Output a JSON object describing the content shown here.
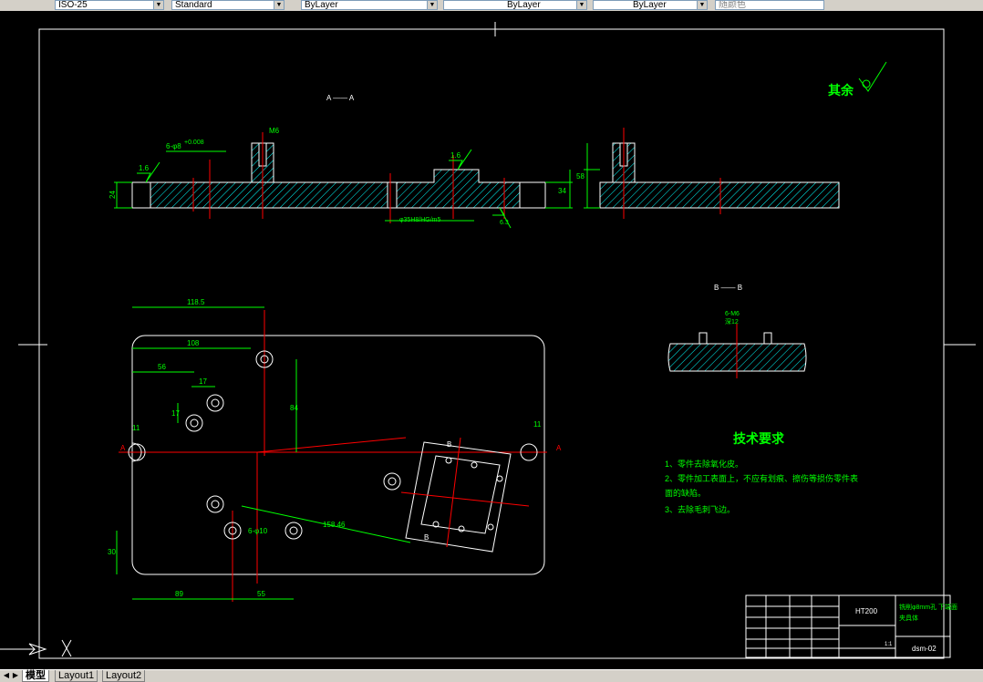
{
  "toolbar": {
    "dimstyle": "ISO-25",
    "textstyle": "Standard",
    "layer_color": "ByLayer",
    "linetype": "ByLayer",
    "lineweight": "ByLayer",
    "plotstyle": "随颜色"
  },
  "drawing": {
    "section_aa": "A —— A",
    "section_bb": "B —— B",
    "roughness_other": "其余",
    "dim_m6": "M6",
    "dim_6phi": "6-φ8",
    "dim_tol": "+0.008",
    "dim_1_6": "1.6",
    "dim_1_6b": "1.6",
    "dim_24": "24",
    "dim_34": "34",
    "dim_58": "58",
    "dim_hole": "φ35H8/HG/m5",
    "dim_6_3": "6.3",
    "dim_118_5": "118.5",
    "dim_108": "108",
    "dim_56": "56",
    "dim_17": "17",
    "dim_17b": "17",
    "dim_84": "84",
    "dim_11": "11",
    "dim_11b": "11",
    "dim_89": "89",
    "dim_55": "55",
    "dim_30": "30",
    "dim_158": "158.46",
    "dim_6phi10": "6-φ10",
    "dim_bb_m6": "6-M6",
    "dim_bb_depth": "深12",
    "label_a": "A",
    "label_b": "B",
    "tech_title": "技术要求",
    "tech_1": "1、零件去除氧化皮。",
    "tech_2a": "2、零件加工表面上，不应有划痕、擦伤等损伤零件表",
    "tech_2b": "面的缺陷。",
    "tech_3": "3、去除毛刺飞边。",
    "tb_material": "HT200",
    "tb_name1": "铣削φ8mm孔 下端面",
    "tb_name2": "夹具体",
    "tb_code": "dsm-02",
    "tb_scale": "1:1"
  },
  "layout_tabs": [
    "模型",
    "Layout1",
    "Layout2"
  ],
  "colors": {
    "frame": "#ffffff",
    "dim": "#00ff00",
    "center": "#ff0000",
    "hatch": "#00ffff",
    "text_green": "#00ff00"
  }
}
